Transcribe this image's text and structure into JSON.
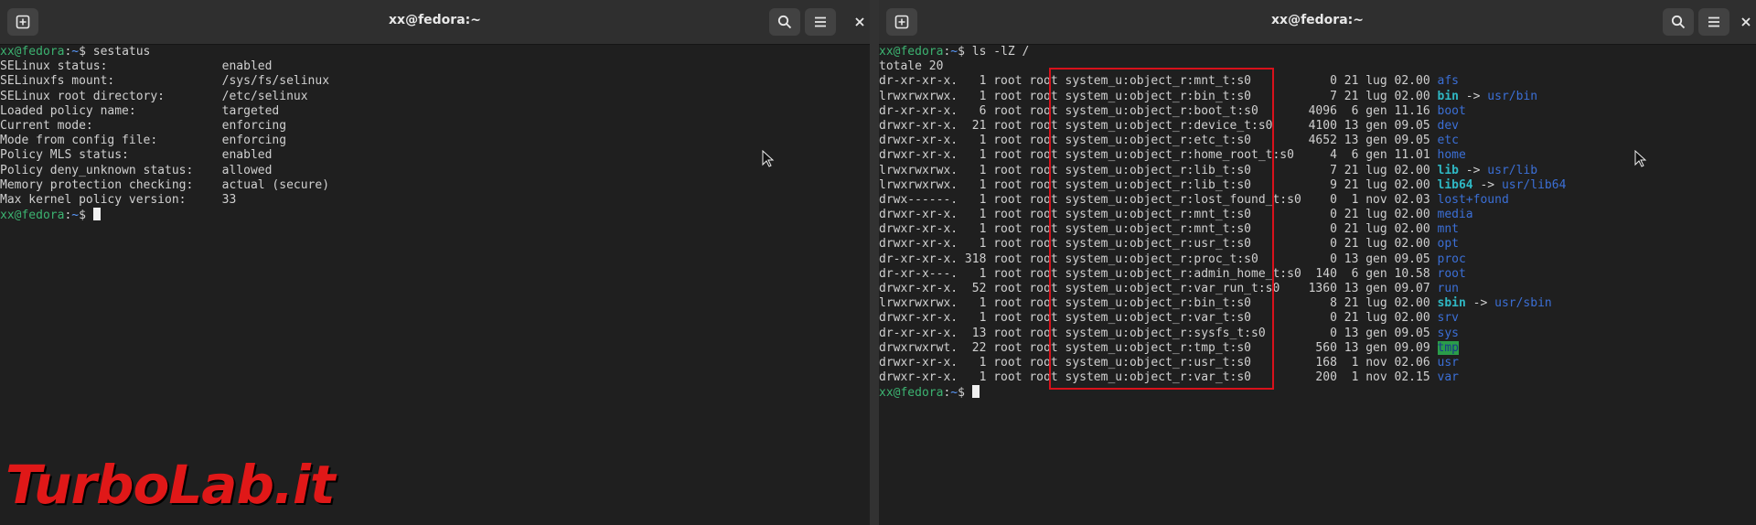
{
  "left_window": {
    "title": "xx@fedora:~",
    "buttons": {
      "new_tab": "new-tab-icon",
      "search": "search-icon",
      "menu": "menu-icon",
      "close": "close-icon"
    },
    "prompt1": {
      "user": "xx@fedora",
      "sep": ":",
      "path": "~",
      "sym": "$ ",
      "cmd": "sestatus"
    },
    "sestatus": [
      {
        "key": "SELinux status:",
        "value": "enabled"
      },
      {
        "key": "SELinuxfs mount:",
        "value": "/sys/fs/selinux"
      },
      {
        "key": "SELinux root directory:",
        "value": "/etc/selinux"
      },
      {
        "key": "Loaded policy name:",
        "value": "targeted"
      },
      {
        "key": "Current mode:",
        "value": "enforcing"
      },
      {
        "key": "Mode from config file:",
        "value": "enforcing"
      },
      {
        "key": "Policy MLS status:",
        "value": "enabled"
      },
      {
        "key": "Policy deny_unknown status:",
        "value": "allowed"
      },
      {
        "key": "Memory protection checking:",
        "value": "actual (secure)"
      },
      {
        "key": "Max kernel policy version:",
        "value": "33"
      }
    ],
    "prompt2": {
      "user": "xx@fedora",
      "sep": ":",
      "path": "~",
      "sym": "$ "
    }
  },
  "right_window": {
    "title": "xx@fedora:~",
    "buttons": {
      "new_tab": "new-tab-icon",
      "search": "search-icon",
      "menu": "menu-icon",
      "close": "close-icon"
    },
    "prompt1": {
      "user": "xx@fedora",
      "sep": ":",
      "path": "~",
      "sym": "$ ",
      "cmd": "ls -lZ /"
    },
    "total": "totale 20",
    "listing": [
      {
        "perms": "dr-xr-xr-x.",
        "links": "1",
        "owner": "root",
        "group": "root",
        "context": "system_u:object_r:mnt_t:s0",
        "size": "0",
        "day": "21",
        "month": "lug",
        "time": "02.00",
        "name": "afs",
        "kind": "dir",
        "target": ""
      },
      {
        "perms": "lrwxrwxrwx.",
        "links": "1",
        "owner": "root",
        "group": "root",
        "context": "system_u:object_r:bin_t:s0",
        "size": "7",
        "day": "21",
        "month": "lug",
        "time": "02.00",
        "name": "bin",
        "kind": "link",
        "target": "usr/bin"
      },
      {
        "perms": "dr-xr-xr-x.",
        "links": "6",
        "owner": "root",
        "group": "root",
        "context": "system_u:object_r:boot_t:s0",
        "size": "4096",
        "day": "6",
        "month": "gen",
        "time": "11.16",
        "name": "boot",
        "kind": "dir",
        "target": ""
      },
      {
        "perms": "drwxr-xr-x.",
        "links": "21",
        "owner": "root",
        "group": "root",
        "context": "system_u:object_r:device_t:s0",
        "size": "4100",
        "day": "13",
        "month": "gen",
        "time": "09.05",
        "name": "dev",
        "kind": "dir",
        "target": ""
      },
      {
        "perms": "drwxr-xr-x.",
        "links": "1",
        "owner": "root",
        "group": "root",
        "context": "system_u:object_r:etc_t:s0",
        "size": "4652",
        "day": "13",
        "month": "gen",
        "time": "09.05",
        "name": "etc",
        "kind": "dir",
        "target": ""
      },
      {
        "perms": "drwxr-xr-x.",
        "links": "1",
        "owner": "root",
        "group": "root",
        "context": "system_u:object_r:home_root_t:s0",
        "size": "4",
        "day": "6",
        "month": "gen",
        "time": "11.01",
        "name": "home",
        "kind": "dir",
        "target": ""
      },
      {
        "perms": "lrwxrwxrwx.",
        "links": "1",
        "owner": "root",
        "group": "root",
        "context": "system_u:object_r:lib_t:s0",
        "size": "7",
        "day": "21",
        "month": "lug",
        "time": "02.00",
        "name": "lib",
        "kind": "link",
        "target": "usr/lib"
      },
      {
        "perms": "lrwxrwxrwx.",
        "links": "1",
        "owner": "root",
        "group": "root",
        "context": "system_u:object_r:lib_t:s0",
        "size": "9",
        "day": "21",
        "month": "lug",
        "time": "02.00",
        "name": "lib64",
        "kind": "link",
        "target": "usr/lib64"
      },
      {
        "perms": "drwx------.",
        "links": "1",
        "owner": "root",
        "group": "root",
        "context": "system_u:object_r:lost_found_t:s0",
        "size": "0",
        "day": "1",
        "month": "nov",
        "time": "02.03",
        "name": "lost+found",
        "kind": "dir",
        "target": ""
      },
      {
        "perms": "drwxr-xr-x.",
        "links": "1",
        "owner": "root",
        "group": "root",
        "context": "system_u:object_r:mnt_t:s0",
        "size": "0",
        "day": "21",
        "month": "lug",
        "time": "02.00",
        "name": "media",
        "kind": "dir",
        "target": ""
      },
      {
        "perms": "drwxr-xr-x.",
        "links": "1",
        "owner": "root",
        "group": "root",
        "context": "system_u:object_r:mnt_t:s0",
        "size": "0",
        "day": "21",
        "month": "lug",
        "time": "02.00",
        "name": "mnt",
        "kind": "dir",
        "target": ""
      },
      {
        "perms": "drwxr-xr-x.",
        "links": "1",
        "owner": "root",
        "group": "root",
        "context": "system_u:object_r:usr_t:s0",
        "size": "0",
        "day": "21",
        "month": "lug",
        "time": "02.00",
        "name": "opt",
        "kind": "dir",
        "target": ""
      },
      {
        "perms": "dr-xr-xr-x.",
        "links": "318",
        "owner": "root",
        "group": "root",
        "context": "system_u:object_r:proc_t:s0",
        "size": "0",
        "day": "13",
        "month": "gen",
        "time": "09.05",
        "name": "proc",
        "kind": "dir",
        "target": ""
      },
      {
        "perms": "dr-xr-x---.",
        "links": "1",
        "owner": "root",
        "group": "root",
        "context": "system_u:object_r:admin_home_t:s0",
        "size": "140",
        "day": "6",
        "month": "gen",
        "time": "10.58",
        "name": "root",
        "kind": "dir",
        "target": ""
      },
      {
        "perms": "drwxr-xr-x.",
        "links": "52",
        "owner": "root",
        "group": "root",
        "context": "system_u:object_r:var_run_t:s0",
        "size": "1360",
        "day": "13",
        "month": "gen",
        "time": "09.07",
        "name": "run",
        "kind": "dir",
        "target": ""
      },
      {
        "perms": "lrwxrwxrwx.",
        "links": "1",
        "owner": "root",
        "group": "root",
        "context": "system_u:object_r:bin_t:s0",
        "size": "8",
        "day": "21",
        "month": "lug",
        "time": "02.00",
        "name": "sbin",
        "kind": "link",
        "target": "usr/sbin"
      },
      {
        "perms": "drwxr-xr-x.",
        "links": "1",
        "owner": "root",
        "group": "root",
        "context": "system_u:object_r:var_t:s0",
        "size": "0",
        "day": "21",
        "month": "lug",
        "time": "02.00",
        "name": "srv",
        "kind": "dir",
        "target": ""
      },
      {
        "perms": "dr-xr-xr-x.",
        "links": "13",
        "owner": "root",
        "group": "root",
        "context": "system_u:object_r:sysfs_t:s0",
        "size": "0",
        "day": "13",
        "month": "gen",
        "time": "09.05",
        "name": "sys",
        "kind": "dir",
        "target": ""
      },
      {
        "perms": "drwxrwxrwt.",
        "links": "22",
        "owner": "root",
        "group": "root",
        "context": "system_u:object_r:tmp_t:s0",
        "size": "560",
        "day": "13",
        "month": "gen",
        "time": "09.09",
        "name": "tmp",
        "kind": "sticky",
        "target": ""
      },
      {
        "perms": "drwxr-xr-x.",
        "links": "1",
        "owner": "root",
        "group": "root",
        "context": "system_u:object_r:usr_t:s0",
        "size": "168",
        "day": "1",
        "month": "nov",
        "time": "02.06",
        "name": "usr",
        "kind": "dir",
        "target": ""
      },
      {
        "perms": "drwxr-xr-x.",
        "links": "1",
        "owner": "root",
        "group": "root",
        "context": "system_u:object_r:var_t:s0",
        "size": "200",
        "day": "1",
        "month": "nov",
        "time": "02.15",
        "name": "var",
        "kind": "dir",
        "target": ""
      }
    ],
    "prompt2": {
      "user": "xx@fedora",
      "sep": ":",
      "path": "~",
      "sym": "$ "
    }
  },
  "watermark": {
    "text": "TurboLab.it"
  },
  "colors": {
    "highlight_box": "#d8111b",
    "prompt_user": "#3cb371",
    "dir": "#3b6fd6",
    "link": "#2fb8c4",
    "watermark": "#e01818"
  }
}
